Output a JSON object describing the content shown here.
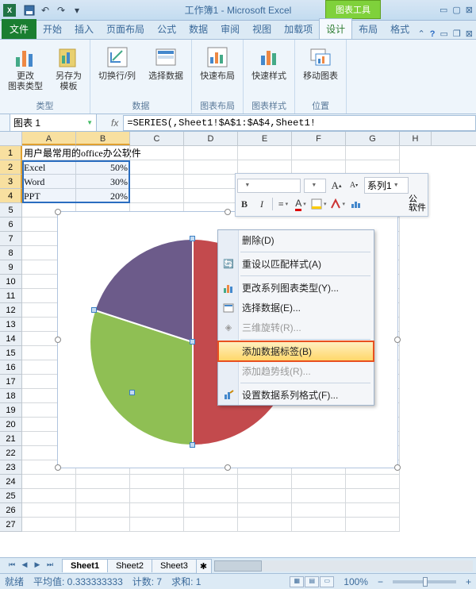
{
  "title": "工作簿1 - Microsoft Excel",
  "chart_tools_label": "图表工具",
  "tabs": {
    "file": "文件",
    "home": "开始",
    "insert": "插入",
    "page_layout": "页面布局",
    "formulas": "公式",
    "data": "数据",
    "review": "审阅",
    "view": "视图",
    "addins": "加载项",
    "design": "设计",
    "layout": "布局",
    "format": "格式"
  },
  "ribbon": {
    "change_chart_type": "更改\n图表类型",
    "save_as_template": "另存为\n模板",
    "group_type": "类型",
    "switch_row_col": "切换行/列",
    "select_data": "选择数据",
    "group_data": "数据",
    "quick_layout": "快速布局",
    "group_chart_layout": "图表布局",
    "quick_style": "快速样式",
    "group_chart_style": "图表样式",
    "move_chart": "移动图表",
    "group_location": "位置"
  },
  "name_box": "图表 1",
  "formula": "=SERIES(,Sheet1!$A$1:$A$4,Sheet1!",
  "cells": {
    "a1": "用户最常用的office办公软件",
    "a2": "Excel",
    "b2": "50%",
    "a3": "Word",
    "b3": "30%",
    "a4": "PPT",
    "b4": "20%"
  },
  "chart_data": {
    "type": "pie",
    "categories": [
      "Excel",
      "Word",
      "PPT"
    ],
    "values": [
      50,
      30,
      20
    ],
    "title": "用户最常用的office办公软件",
    "series_name": "系列1",
    "colors": [
      "#C34A4D",
      "#6C5B8A",
      "#8FBF54"
    ]
  },
  "mini_toolbar": {
    "series_label": "系列1",
    "legend_label": "公\n软件",
    "bold": "B",
    "italic": "I",
    "font_inc": "A",
    "font_dec": "A"
  },
  "context_menu": {
    "delete": "删除(D)",
    "reset_match_style": "重设以匹配样式(A)",
    "change_series_chart_type": "更改系列图表类型(Y)...",
    "select_data": "选择数据(E)...",
    "rotate_3d": "三维旋转(R)...",
    "add_data_labels": "添加数据标签(B)",
    "add_trendline": "添加趋势线(R)...",
    "format_data_series": "设置数据系列格式(F)..."
  },
  "sheets": {
    "s1": "Sheet1",
    "s2": "Sheet2",
    "s3": "Sheet3"
  },
  "status": {
    "ready": "就绪",
    "avg_label": "平均值: 0.333333333",
    "count_label": "计数: 7",
    "sum_label": "求和: 1",
    "zoom": "100%"
  }
}
